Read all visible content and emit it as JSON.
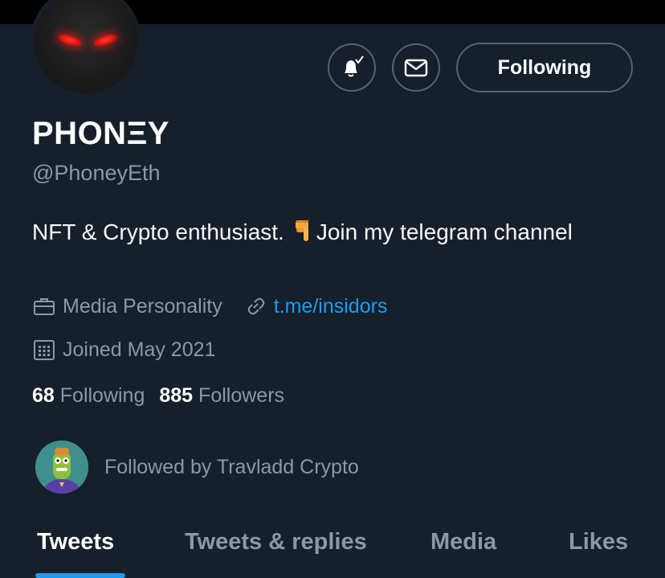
{
  "profile": {
    "display_name": "PHONΞY",
    "handle": "@PhoneyEth",
    "bio_text": "NFT & Crypto enthusiast.",
    "bio_emoji": "pointing-down-emoji",
    "bio_link_text": "Join my telegram channel",
    "category": "Media Personality",
    "website": "t.me/insidors",
    "joined": "Joined May 2021",
    "following_count": "68",
    "following_label": "Following",
    "followers_count": "885",
    "followers_label": "Followers",
    "followed_by": "Followed by Travladd Crypto"
  },
  "actions": {
    "following_button": "Following",
    "bell_icon": "bell-check-icon",
    "mail_icon": "envelope-icon"
  },
  "tabs": [
    {
      "label": "Tweets",
      "active": true
    },
    {
      "label": "Tweets & replies",
      "active": false
    },
    {
      "label": "Media",
      "active": false
    },
    {
      "label": "Likes",
      "active": false
    }
  ],
  "colors": {
    "background": "#15202b",
    "accent": "#1d9bf0",
    "muted_text": "#8b98a5",
    "border": "#536471"
  }
}
